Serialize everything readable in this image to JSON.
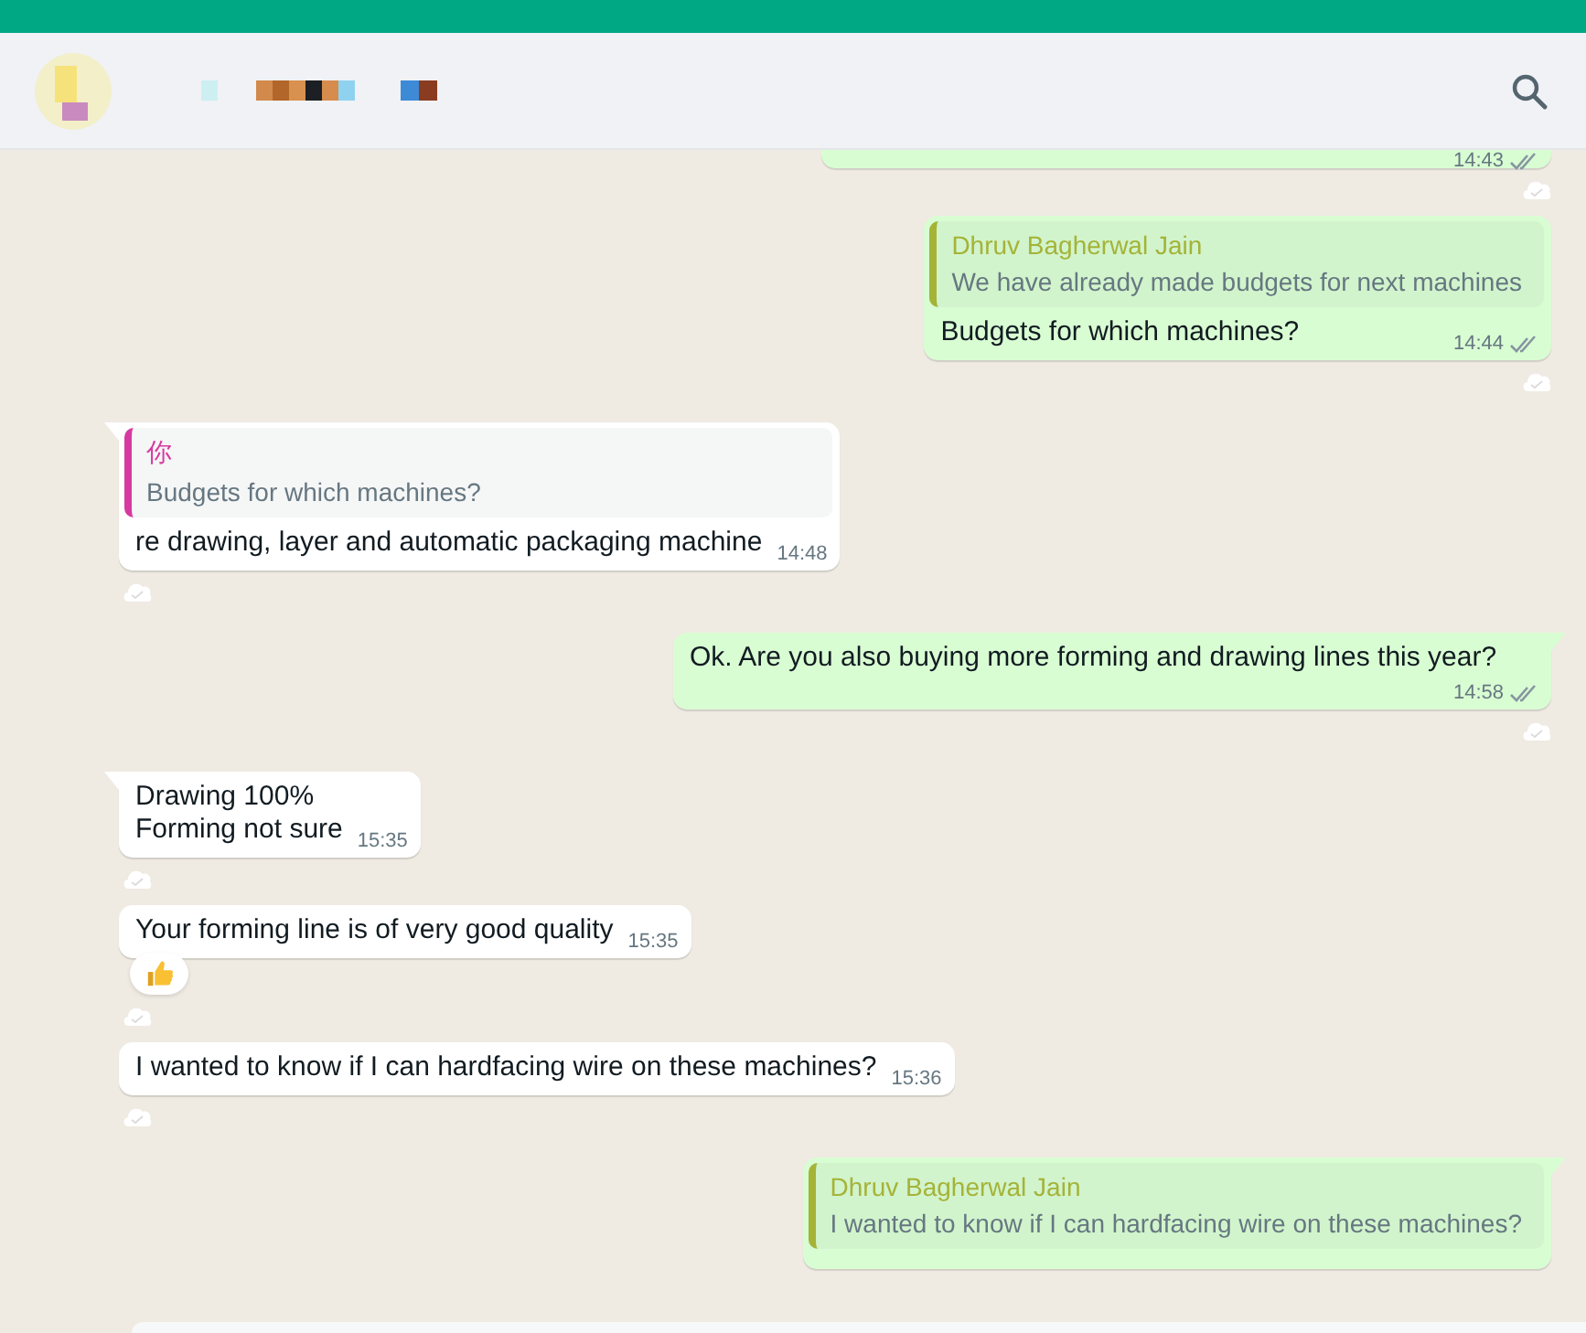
{
  "messages": [
    {
      "kind": "outgoing",
      "time": "14:43",
      "read": false,
      "tail": false
    },
    {
      "kind": "outgoing",
      "quote": {
        "author": "Dhruv Bagherwal Jain",
        "text": "We have already made budgets for next machines",
        "color": "#a5b337"
      },
      "text": "Budgets for which machines?",
      "time": "14:44",
      "read": false,
      "tail": false
    },
    {
      "kind": "incoming",
      "quote": {
        "author": "你",
        "text": "Budgets for which machines?",
        "color": "#d63aa0"
      },
      "text": "re drawing, layer and automatic packaging machine",
      "time": "14:48",
      "tail": true
    },
    {
      "kind": "outgoing",
      "text": "Ok. Are you also buying more forming and drawing lines this year?",
      "time": "14:58",
      "read": false,
      "tail": true
    },
    {
      "kind": "incoming",
      "text": "Drawing 100%\nForming not sure",
      "time": "15:35",
      "tail": true
    },
    {
      "kind": "incoming",
      "text": "Your forming line is of very good quality",
      "time": "15:35",
      "tail": false,
      "reaction": true
    },
    {
      "kind": "incoming",
      "text": "I wanted to know if I can hardfacing wire on these machines?",
      "time": "15:36",
      "tail": false
    },
    {
      "kind": "outgoing",
      "quote": {
        "author": "Dhruv Bagherwal Jain",
        "text": "I wanted to know if I can hardfacing wire on these machines?",
        "color": "#a5b337"
      },
      "tail": true
    }
  ]
}
